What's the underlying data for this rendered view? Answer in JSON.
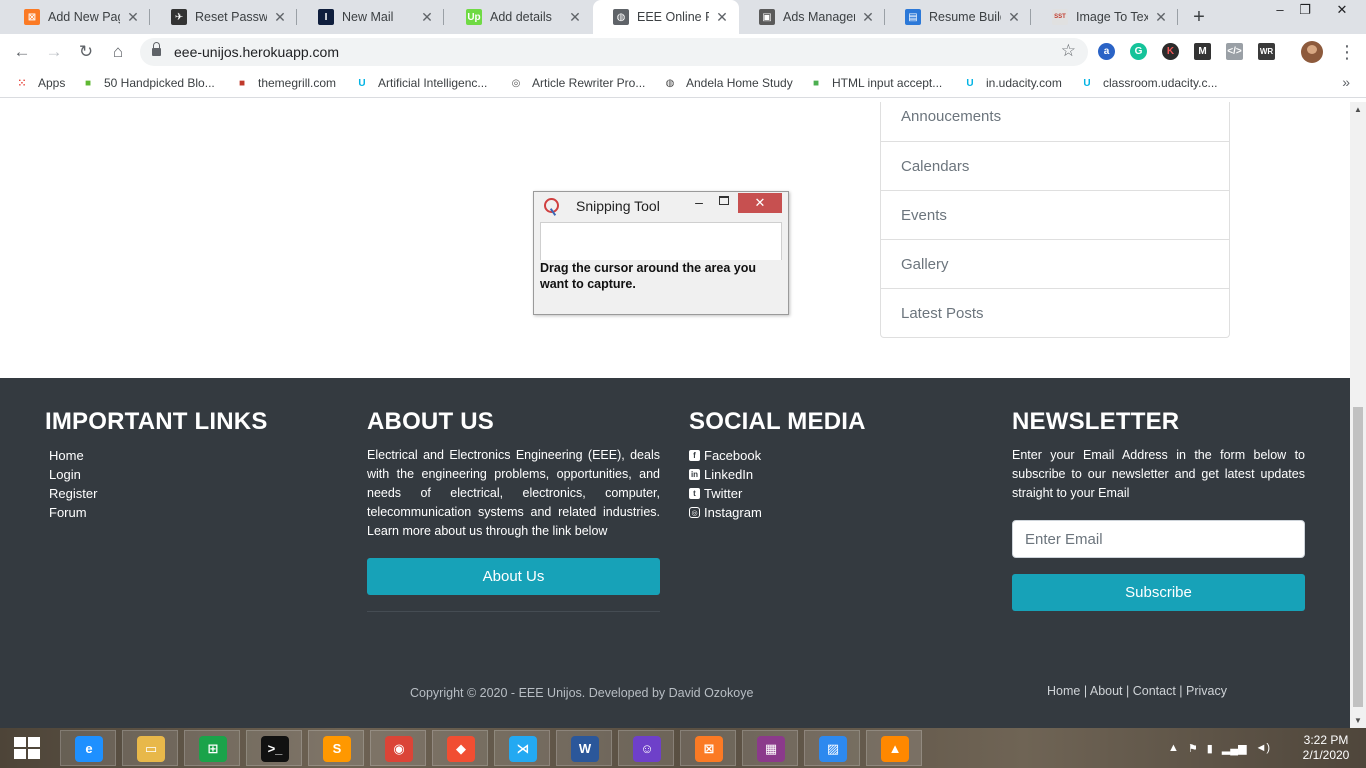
{
  "browser": {
    "tabs": [
      {
        "title": "Add New Page",
        "icon": "xampp-icon",
        "color": "#fb7a24",
        "glyph": "⊠"
      },
      {
        "title": "Reset Password",
        "icon": "bot-icon",
        "color": "#333333",
        "glyph": "✈"
      },
      {
        "title": "New Mail",
        "icon": "mail-icon",
        "color": "#0f1e3d",
        "glyph": "I"
      },
      {
        "title": "Add details",
        "icon": "upwork-icon",
        "color": "#6fda44",
        "glyph": "Up"
      },
      {
        "title": "EEE Online Reg",
        "icon": "globe-icon",
        "color": "#5f6368",
        "glyph": "◍"
      },
      {
        "title": "Ads Manager -",
        "icon": "ads-icon",
        "color": "#5a5a5a",
        "glyph": "▣"
      },
      {
        "title": "Resume Builder",
        "icon": "resume-icon",
        "color": "#2b78d8",
        "glyph": "▤"
      },
      {
        "title": "Image To Text",
        "icon": "sst-icon",
        "color": "#e0e0e0",
        "glyph": "SST"
      }
    ],
    "new_tab": "+",
    "window_controls": {
      "minimize": "–",
      "restore": "❐",
      "close": "✕"
    },
    "url": "eee-unijos.herokuapp.com",
    "bookmarks": [
      {
        "label": "Apps",
        "icon": "apps-grid-icon",
        "color": "#e8453c"
      },
      {
        "label": "50 Handpicked Blo...",
        "icon": "blog-icon",
        "color": "#5fb832"
      },
      {
        "label": "themegrill.com",
        "icon": "themegrill-icon",
        "color": "#c0392b"
      },
      {
        "label": "Artificial Intelligenc...",
        "icon": "udacity-icon",
        "color": "#02b3e4"
      },
      {
        "label": "Article Rewriter Pro...",
        "icon": "seo-icon",
        "color": "#555555"
      },
      {
        "label": "Andela Home Study",
        "icon": "globe-icon",
        "color": "#444444"
      },
      {
        "label": "HTML input accept...",
        "icon": "w3-icon",
        "color": "#4caf50"
      },
      {
        "label": "in.udacity.com",
        "icon": "udacity-icon",
        "color": "#02b3e4"
      },
      {
        "label": "classroom.udacity.c...",
        "icon": "udacity-icon",
        "color": "#02b3e4"
      }
    ],
    "bookmarks_more": "»"
  },
  "sidebar": {
    "items": [
      "Annoucements",
      "Calendars",
      "Events",
      "Gallery",
      "Latest Posts"
    ]
  },
  "snipping_tool": {
    "title": "Snipping Tool",
    "message": "Drag the cursor around the area you want to capture."
  },
  "footer": {
    "links": {
      "heading": "IMPORTANT LINKS",
      "items": [
        "Home",
        "Login",
        "Register",
        "Forum"
      ]
    },
    "about": {
      "heading": "ABOUT US",
      "text": "Electrical and Electronics Engineering (EEE), deals with the engineering problems, opportunities, and needs of electrical, electronics, computer, telecommunication systems and related industries. Learn more about us through the link below",
      "button": "About Us"
    },
    "social": {
      "heading": "SOCIAL MEDIA",
      "items": [
        {
          "label": "Facebook",
          "icon": "facebook-icon",
          "glyph": "f"
        },
        {
          "label": "LinkedIn",
          "icon": "linkedin-icon",
          "glyph": "in"
        },
        {
          "label": "Twitter",
          "icon": "twitter-icon",
          "glyph": "t"
        },
        {
          "label": "Instagram",
          "icon": "instagram-icon",
          "glyph": "◎"
        }
      ]
    },
    "newsletter": {
      "heading": "NEWSLETTER",
      "text": "Enter your Email Address in the form below to subscribe to our newsletter and get latest updates straight to your Email",
      "placeholder": "Enter Email",
      "button": "Subscribe"
    },
    "copyright": "Copyright © 2020 - EEE Unijos. Developed by David Ozokoye",
    "legal": [
      "Home",
      "About",
      "Contact",
      "Privacy"
    ]
  },
  "taskbar": {
    "apps": [
      {
        "name": "internet-explorer-icon",
        "color": "#1e90ff",
        "glyph": "e"
      },
      {
        "name": "file-explorer-icon",
        "color": "#e8b84a",
        "glyph": "▭"
      },
      {
        "name": "store-icon",
        "color": "#1aa34a",
        "glyph": "⊞"
      },
      {
        "name": "command-prompt-icon",
        "color": "#111111",
        "glyph": ">_"
      },
      {
        "name": "sublime-text-icon",
        "color": "#ff9800",
        "glyph": "S"
      },
      {
        "name": "chrome-icon",
        "color": "#db4437",
        "glyph": "◉"
      },
      {
        "name": "git-icon",
        "color": "#f14e32",
        "glyph": "◆"
      },
      {
        "name": "vscode-icon",
        "color": "#23a9f2",
        "glyph": "⋊"
      },
      {
        "name": "word-icon",
        "color": "#2b579a",
        "glyph": "W"
      },
      {
        "name": "github-desktop-icon",
        "color": "#6e40c9",
        "glyph": "☺"
      },
      {
        "name": "xampp-icon",
        "color": "#fb7a24",
        "glyph": "⊠"
      },
      {
        "name": "winrar-icon",
        "color": "#8b3a8b",
        "glyph": "▦"
      },
      {
        "name": "photos-icon",
        "color": "#2d89ef",
        "glyph": "▨"
      },
      {
        "name": "vlc-icon",
        "color": "#ff8800",
        "glyph": "▲"
      }
    ],
    "time": "3:22 PM",
    "date": "2/1/2020"
  }
}
